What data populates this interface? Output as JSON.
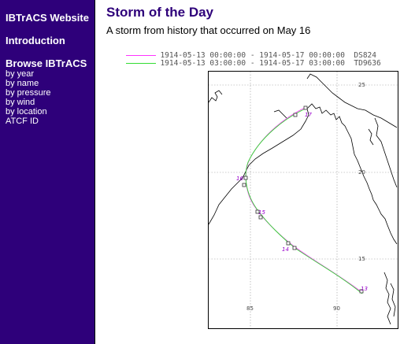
{
  "sidebar": {
    "site_link": "IBTrACS Website",
    "intro_link": "Introduction",
    "browse_heading": "Browse IBTrACS",
    "items": [
      "by year",
      "by name",
      "by pressure",
      "by wind",
      "by location",
      "ATCF ID"
    ]
  },
  "main": {
    "title": "Storm of the Day",
    "subtitle": "A storm from history that occurred on May 16"
  },
  "legend": [
    {
      "text": "1914-05-13 00:00:00 - 1914-05-17 00:00:00  DS824",
      "color": "#ff33ff"
    },
    {
      "text": "1914-05-13 03:00:00 - 1914-05-17 03:00:00  TD9636",
      "color": "#33dd33"
    }
  ],
  "map": {
    "lon_ticks": [
      "85",
      "90"
    ],
    "lat_ticks": [
      "25",
      "20",
      "15"
    ],
    "day_labels": [
      "17",
      "16",
      "15",
      "14",
      "13"
    ],
    "colors": {
      "track1": "#ff33ff",
      "track2": "#33dd33",
      "coast": "#000000"
    }
  }
}
